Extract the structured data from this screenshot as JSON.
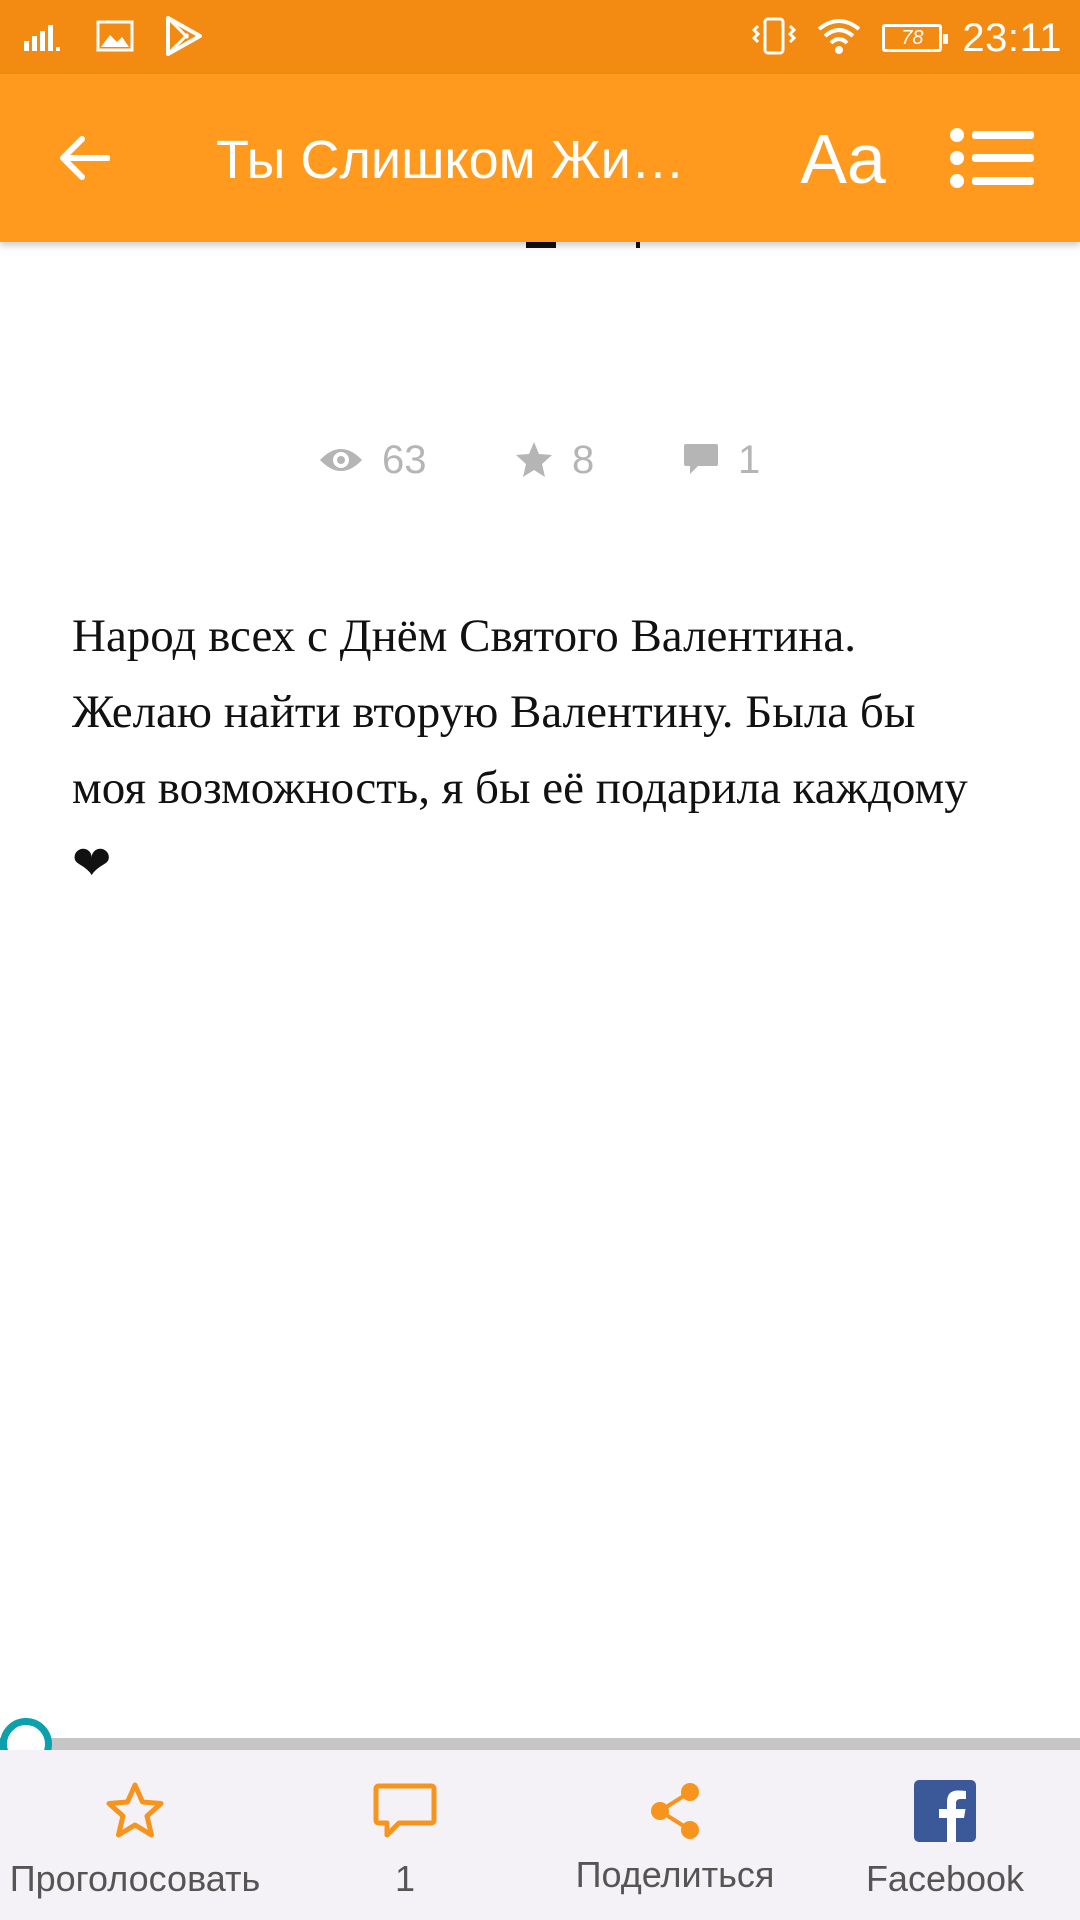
{
  "status_bar": {
    "time": "23:11",
    "battery_level": "78",
    "icons": [
      "signal-icon",
      "image-notification-icon",
      "play-store-icon",
      "vibrate-icon",
      "wifi-icon",
      "battery-icon"
    ]
  },
  "app_bar": {
    "title": "Ты Слишком Жир…",
    "font_button_label": "Aa",
    "icons": [
      "back-arrow-icon",
      "list-menu-icon"
    ]
  },
  "stats": {
    "views": "63",
    "stars": "8",
    "comments": "1"
  },
  "story": {
    "text": "Народ всех с Днём Святого Валентина. Желаю найти вторую Валентину. Была бы моя возможность, я бы её подарила каждому❤"
  },
  "reading_progress": {
    "fraction": 0.02
  },
  "bottom_bar": {
    "vote_label": "Проголосовать",
    "comments_label": "1",
    "share_label": "Поделиться",
    "facebook_label": "Facebook"
  },
  "colors": {
    "status_bar": "#f38b12",
    "app_bar": "#ff9a1e",
    "accent_orange": "#f7941d",
    "progress": "#0aa0ac",
    "facebook": "#3b5998",
    "stat_grey": "#b5b5b5"
  }
}
